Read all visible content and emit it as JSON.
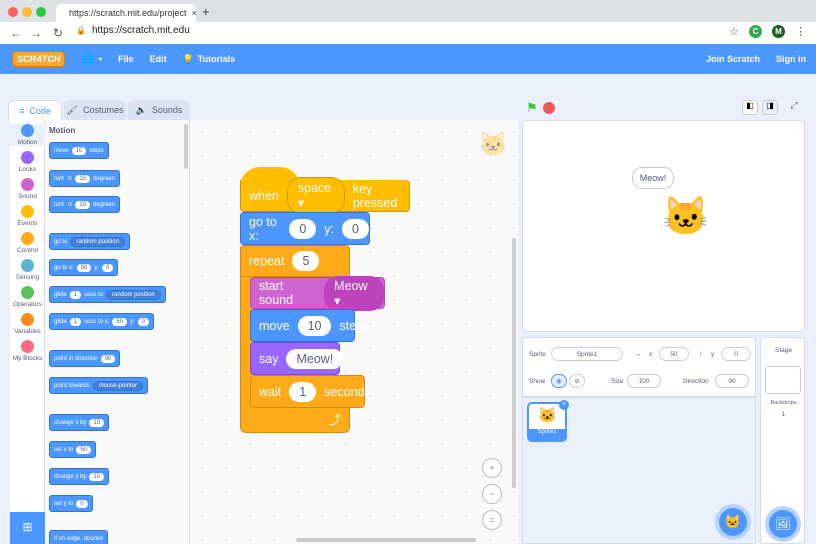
{
  "browser": {
    "tab_title": "https://scratch.mit.edu/project",
    "tab_close": "×",
    "new_tab": "+",
    "url": "https://scratch.mit.edu",
    "profile_initial": "M",
    "ext_initial": "C"
  },
  "menubar": {
    "logo": "SCRATCH",
    "items": [
      "File",
      "Edit",
      "Tutorials"
    ],
    "join": "Join Scratch",
    "signin": "Sign in"
  },
  "tabs": {
    "code": "Code",
    "costumes": "Costumes",
    "sounds": "Sounds"
  },
  "categories": [
    {
      "label": "Motion",
      "color": "#4c97ff"
    },
    {
      "label": "Looks",
      "color": "#9966ff"
    },
    {
      "label": "Sound",
      "color": "#cf63cf"
    },
    {
      "label": "Events",
      "color": "#ffbf00"
    },
    {
      "label": "Control",
      "color": "#ffab19"
    },
    {
      "label": "Sensing",
      "color": "#5cb1d6"
    },
    {
      "label": "Operators",
      "color": "#59c059"
    },
    {
      "label": "Variables",
      "color": "#ff8c1a"
    },
    {
      "label": "My Blocks",
      "color": "#ff6680"
    }
  ],
  "palette": {
    "title": "Motion",
    "move": {
      "pre": "move",
      "val": "10",
      "post": "steps"
    },
    "turn_right": {
      "pre": "turn",
      "val": "15",
      "post": "degrees"
    },
    "turn_left": {
      "pre": "turn",
      "val": "15",
      "post": "degrees"
    },
    "goto": {
      "pre": "go to",
      "drop": "random position"
    },
    "gotoxy": {
      "pre": "go to x:",
      "x": "50",
      "ylabel": "y:",
      "y": "0"
    },
    "glide": {
      "pre": "glide",
      "val": "1",
      "mid": "secs to",
      "drop": "random position"
    },
    "glidexy": {
      "pre": "glide",
      "val": "1",
      "mid": "secs to x:",
      "x": "50",
      "ylabel": "y:",
      "y": "0"
    },
    "point": {
      "pre": "point in direction",
      "val": "90"
    },
    "pointtowards": {
      "pre": "point towards",
      "drop": "mouse-pointer"
    },
    "changex": {
      "pre": "change x by",
      "val": "10"
    },
    "setx": {
      "pre": "set x to",
      "val": "50"
    },
    "changey": {
      "pre": "change y by",
      "val": "10"
    },
    "sety": {
      "pre": "set y to",
      "val": "0"
    },
    "bounce": {
      "pre": "if on edge, bounce"
    }
  },
  "script": {
    "hat": {
      "pre": "when",
      "key": "space",
      "post": "key pressed"
    },
    "goto": {
      "pre": "go to x:",
      "x": "0",
      "ylabel": "y:",
      "y": "0"
    },
    "repeat": {
      "pre": "repeat",
      "val": "5"
    },
    "sound": {
      "pre": "start sound",
      "drop": "Meow"
    },
    "move": {
      "pre": "move",
      "val": "10",
      "post": "steps"
    },
    "say": {
      "pre": "say",
      "val": "Meow!"
    },
    "wait": {
      "pre": "wait",
      "val": "1",
      "post": "seconds"
    }
  },
  "stage": {
    "speech": "Meow!"
  },
  "sprite_info": {
    "sprite_label": "Sprite",
    "sprite_name": "Sprite1",
    "x_label": "x",
    "x": "50",
    "y_label": "y",
    "y": "0",
    "show_label": "Show",
    "size_label": "Size",
    "size": "100",
    "direction_label": "Direction",
    "direction": "90"
  },
  "sprite_list": {
    "thumb_label": "Sprite1"
  },
  "stage_panel": {
    "title": "Stage",
    "backdrops_label": "Backdrops",
    "backdrops_count": "1"
  },
  "colors": {
    "accent": "#4c97ff",
    "events": "#ffbf00",
    "control": "#ffab19",
    "sound": "#cf63cf",
    "looks": "#9966ff"
  }
}
